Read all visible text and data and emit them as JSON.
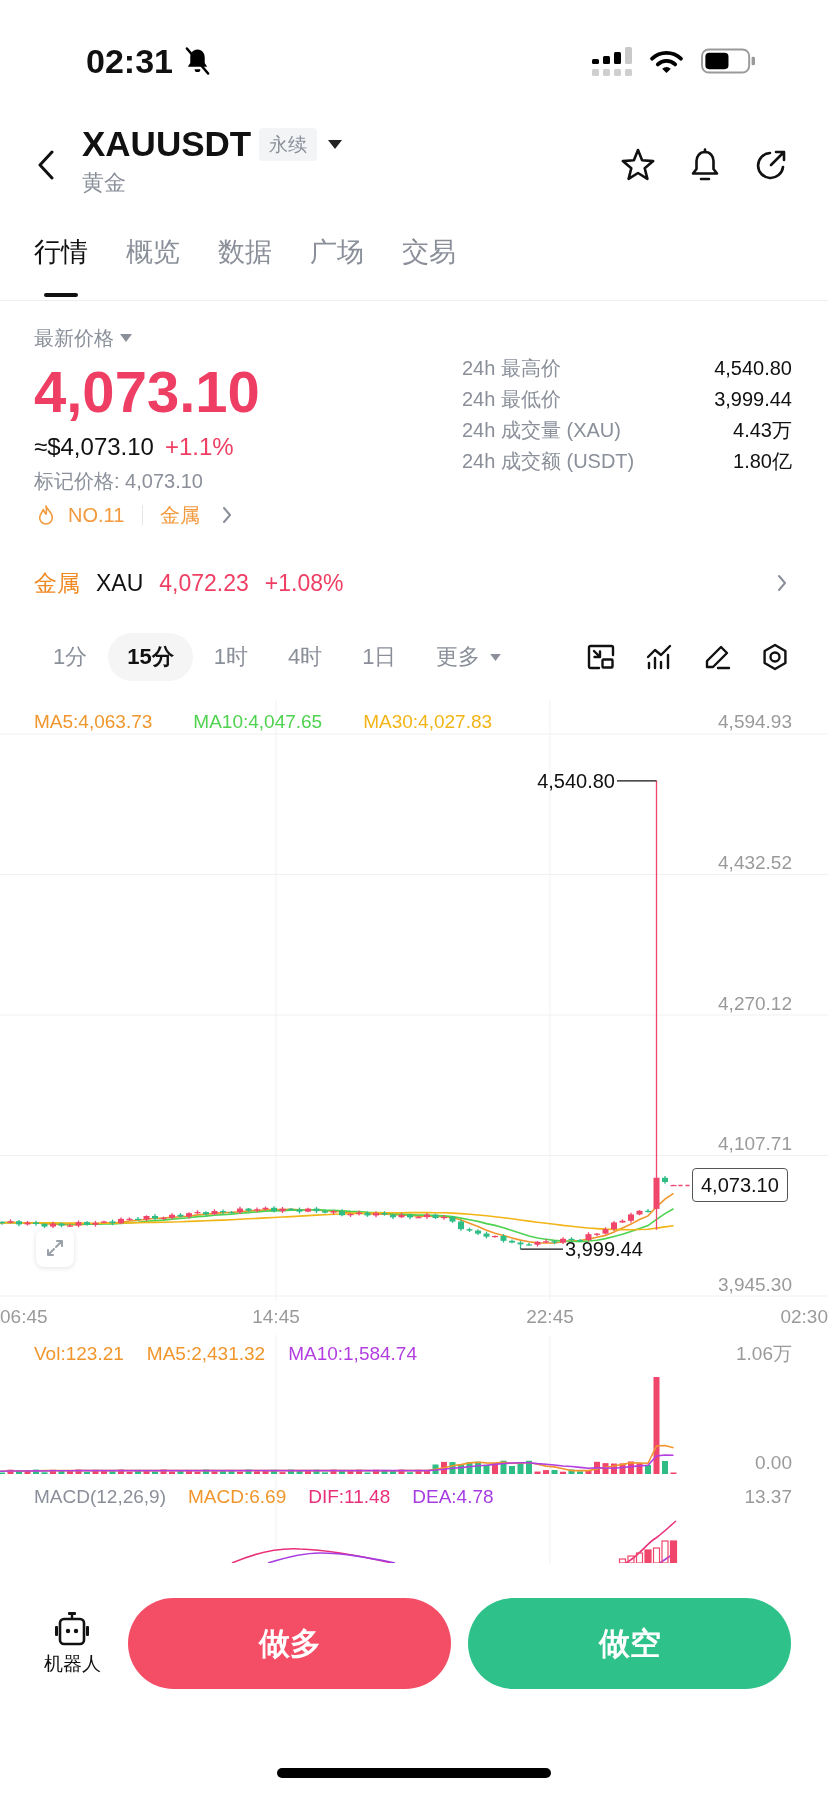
{
  "status_bar": {
    "time": "02:31"
  },
  "header": {
    "symbol": "XAUUSDT",
    "badge": "永续",
    "name": "黄金"
  },
  "tabs": [
    {
      "label": "行情",
      "selected": true
    },
    {
      "label": "概览",
      "selected": false
    },
    {
      "label": "数据",
      "selected": false
    },
    {
      "label": "广场",
      "selected": false
    },
    {
      "label": "交易",
      "selected": false
    }
  ],
  "price": {
    "label": "最新价格",
    "last": "4,073.10",
    "usd": "≈$4,073.10",
    "change": "+1.1%",
    "mark_price": "标记价格: 4,073.10",
    "rank": "NO.11",
    "category": "金属"
  },
  "stats": [
    {
      "label": "24h 最高价",
      "value": "4,540.80"
    },
    {
      "label": "24h 最低价",
      "value": "3,999.44"
    },
    {
      "label": "24h 成交量 (XAU)",
      "value": "4.43万"
    },
    {
      "label": "24h 成交额 (USDT)",
      "value": "1.80亿"
    }
  ],
  "index": {
    "category": "金属",
    "symbol": "XAU",
    "price": "4,072.23",
    "change": "+1.08%"
  },
  "intervals": [
    {
      "label": "1分",
      "selected": false
    },
    {
      "label": "15分",
      "selected": true
    },
    {
      "label": "1时",
      "selected": false
    },
    {
      "label": "4时",
      "selected": false
    },
    {
      "label": "1日",
      "selected": false
    }
  ],
  "more_intervals": {
    "label": "更多"
  },
  "chart": {
    "ma_legend": [
      {
        "label": "MA5:4,063.73",
        "color": "#f0962d"
      },
      {
        "label": "MA10:4,047.65",
        "color": "#4fd24f"
      },
      {
        "label": "MA30:4,027.83",
        "color": "#f2b416"
      }
    ],
    "y_axis": [
      "4,594.93",
      "4,432.52",
      "4,270.12",
      "4,107.71",
      "3,945.30"
    ],
    "high_label": "4,540.80",
    "low_label": "3,999.44",
    "last_price": "4,073.10",
    "x_axis": [
      "06:45",
      "14:45",
      "22:45",
      "02:30"
    ]
  },
  "volume": {
    "legend": [
      {
        "label": "Vol:123.21",
        "color": "#f0962d"
      },
      {
        "label": "MA5:2,431.32",
        "color": "#f0962d"
      },
      {
        "label": "MA10:1,584.74",
        "color": "#b23ee0"
      }
    ],
    "y_axis": [
      "1.06万",
      "0.00"
    ]
  },
  "macd": {
    "legend": [
      {
        "label": "MACD(12,26,9)",
        "color": "#8a8f99"
      },
      {
        "label": "MACD:6.69",
        "color": "#f0962d"
      },
      {
        "label": "DIF:11.48",
        "color": "#e8307a"
      },
      {
        "label": "DEA:4.78",
        "color": "#a63de0"
      }
    ],
    "y_axis": [
      "13.37"
    ]
  },
  "actions": {
    "bot": "机器人",
    "long": "做多",
    "short": "做空"
  }
}
